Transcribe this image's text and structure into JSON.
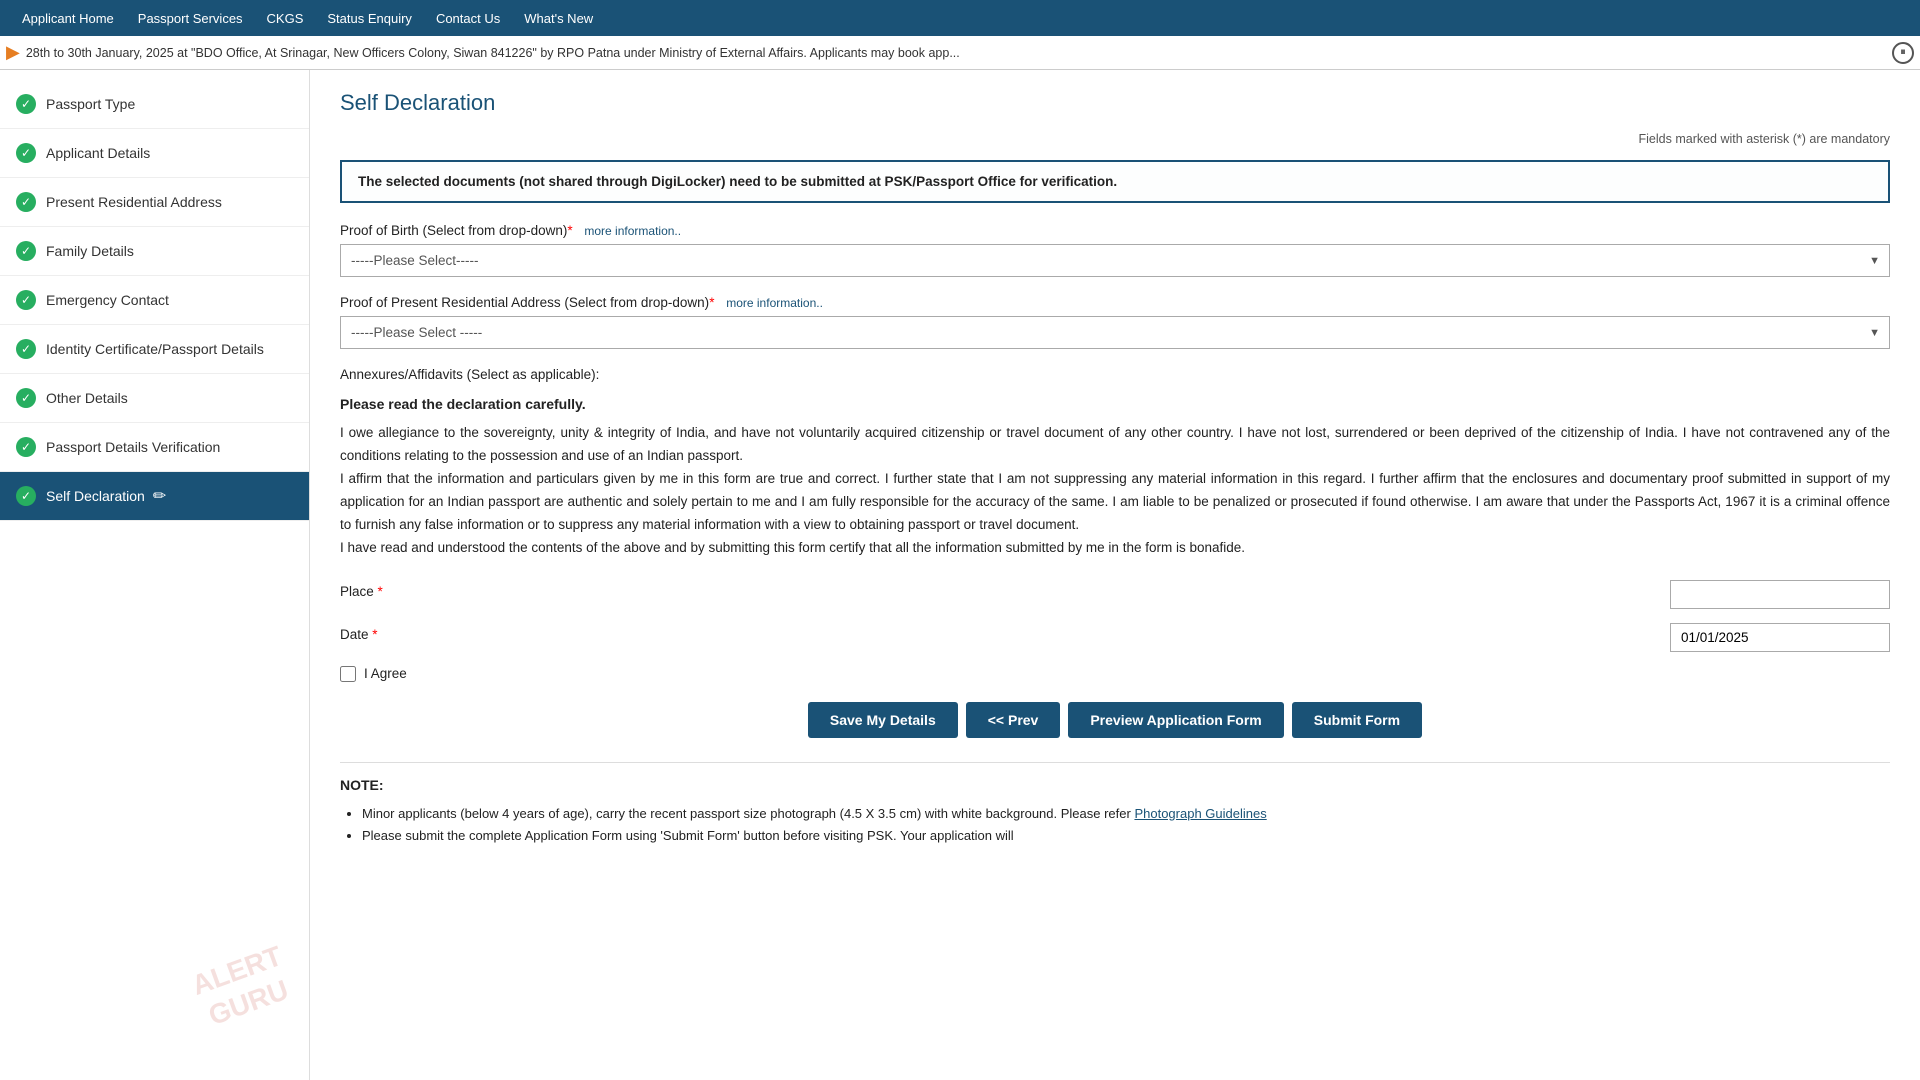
{
  "topnav": {
    "items": [
      {
        "label": "Applicant Home",
        "active": false
      },
      {
        "label": "Passport Services",
        "active": false
      },
      {
        "label": "CKGS",
        "active": false
      },
      {
        "label": "Status Enquiry",
        "active": false
      },
      {
        "label": "Contact Us",
        "active": false
      },
      {
        "label": "What's New",
        "active": false
      }
    ]
  },
  "ticker": {
    "text": "28th to 30th January, 2025 at \"BDO Office, At Srinagar, New Officers Colony, Siwan 841226\" by RPO Patna under Ministry of External Affairs. Applicants may book app..."
  },
  "sidebar": {
    "items": [
      {
        "label": "Passport Type",
        "completed": true,
        "active": false
      },
      {
        "label": "Applicant Details",
        "completed": true,
        "active": false
      },
      {
        "label": "Present Residential Address",
        "completed": true,
        "active": false
      },
      {
        "label": "Family Details",
        "completed": true,
        "active": false
      },
      {
        "label": "Emergency Contact",
        "completed": true,
        "active": false
      },
      {
        "label": "Identity Certificate/Passport Details",
        "completed": true,
        "active": false
      },
      {
        "label": "Other Details",
        "completed": true,
        "active": false
      },
      {
        "label": "Passport Details Verification",
        "completed": true,
        "active": false
      },
      {
        "label": "Self Declaration",
        "completed": false,
        "active": true
      }
    ],
    "watermark_line1": "ALERT",
    "watermark_line2": "GURU"
  },
  "content": {
    "page_title": "Self Declaration",
    "mandatory_note": "Fields marked with asterisk (*) are mandatory",
    "info_box": "The selected documents (not shared through DigiLocker) need to be submitted at PSK/Passport Office for verification.",
    "proof_of_birth_label": "Proof of Birth (Select from drop-down)",
    "proof_of_birth_placeholder": "-----Please Select-----",
    "proof_of_birth_more_info": "more information..",
    "proof_of_address_label": "Proof of Present Residential Address (Select from drop-down)",
    "proof_of_address_placeholder": "-----Please Select -----",
    "proof_of_address_more_info": "more information..",
    "annexures_label": "Annexures/Affidavits (Select as applicable):",
    "declaration_heading": "Please read the declaration carefully.",
    "declaration_text": "I owe allegiance to the sovereignty, unity & integrity of India, and have not voluntarily acquired citizenship or travel document of any other country. I have not lost, surrendered or been deprived of the citizenship of India. I have not contravened any of the conditions relating to the possession and use of an Indian passport.\nI affirm that the information and particulars given by me in this form are true and correct. I further state that I am not suppressing any material information in this regard. I further affirm that the enclosures and documentary proof submitted in support of my application for an Indian passport are authentic and solely pertain to me and I am fully responsible for the accuracy of the same. I am liable to be penalized or prosecuted if found otherwise. I am aware that under the Passports Act, 1967 it is a criminal offence to furnish any false information or to suppress any material information with a view to obtaining passport or travel document.\nI have read and understood the contents of the above and by submitting this form certify that all the information submitted by me in the form is bonafide.",
    "place_label": "Place",
    "date_label": "Date",
    "date_value": "01/01/2025",
    "agree_label": "I Agree",
    "buttons": {
      "save": "Save My Details",
      "prev": "<< Prev",
      "preview": "Preview Application Form",
      "submit": "Submit Form"
    },
    "note_title": "NOTE:",
    "notes": [
      "Minor applicants (below 4 years of age), carry the recent passport size photograph (4.5 X 3.5 cm) with white background. Please refer Photograph Guidelines",
      "Please submit the complete Application Form using 'Submit Form' button before visiting PSK. Your application will"
    ]
  }
}
